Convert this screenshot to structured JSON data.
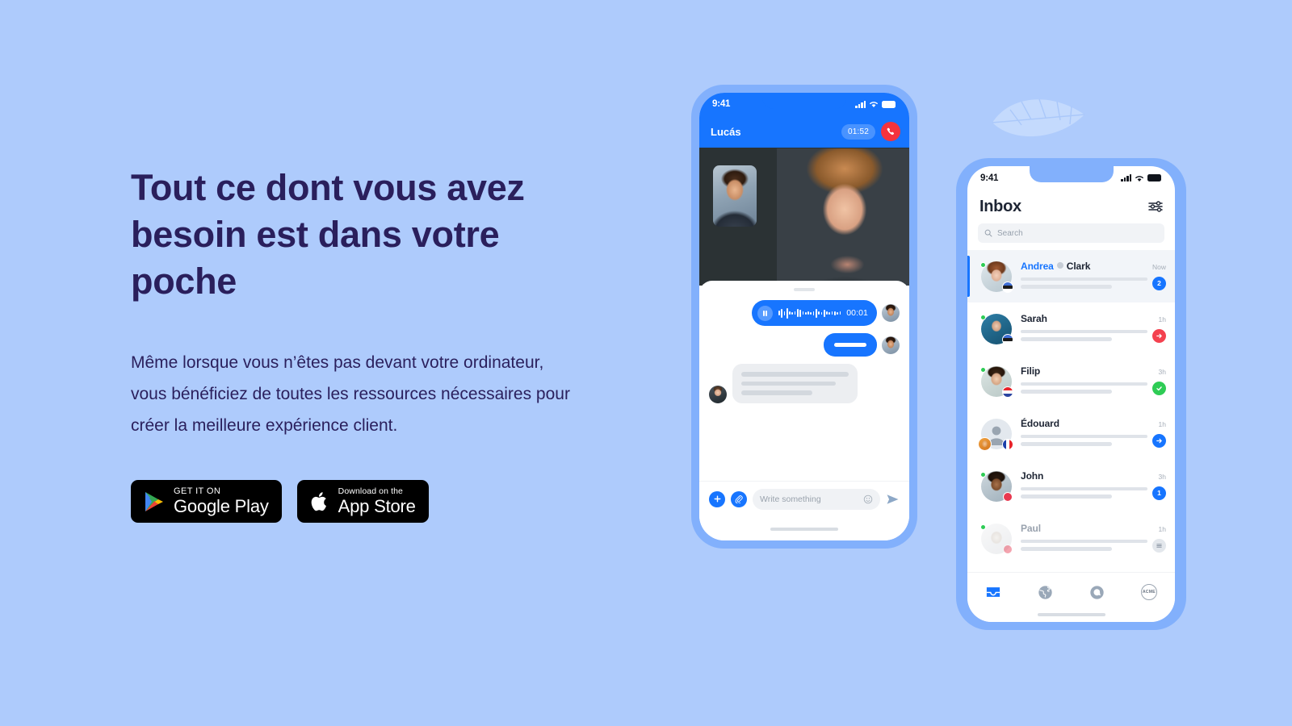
{
  "hero": {
    "headline": "Tout ce dont vous avez besoin est dans votre poche",
    "subcopy": "Même lorsque vous n’êtes pas devant votre ordinateur, vous bénéficiez de toutes les ressources nécessaires pour créer la meilleure expérience client.",
    "badges": [
      {
        "small": "GET IT ON",
        "big": "Google Play",
        "icon": "google-play-icon"
      },
      {
        "small": "Download on the",
        "big": "App Store",
        "icon": "apple-icon"
      }
    ]
  },
  "call_phone": {
    "status": {
      "time": "9:41",
      "signal": "signal-bars-icon",
      "wifi": "wifi-icon",
      "battery": "battery-icon"
    },
    "caller_name": "Lucás",
    "call_timer": "01:52",
    "hangup_label": "hangup-button",
    "messages": {
      "voice": {
        "duration": "00:01",
        "control": "pause-icon"
      },
      "text_bubble": "outgoing-message",
      "incoming_skeleton": "incoming-message"
    },
    "composer": {
      "placeholder": "Write something",
      "add_label": "add-attachment",
      "clip_label": "paperclip",
      "emoji_label": "emoji",
      "send_label": "send"
    }
  },
  "inbox_phone": {
    "status": {
      "time": "9:41"
    },
    "title": "Inbox",
    "filter_label": "filters",
    "search": {
      "placeholder": "Search"
    },
    "conversations": [
      {
        "name_primary": "Andrea",
        "name_secondary": "Clark",
        "time": "Now",
        "badge": "2",
        "badge_type": "count-blue",
        "online": true,
        "flag": "ee",
        "active": true
      },
      {
        "name_primary": "Sarah",
        "name_secondary": "",
        "time": "1h",
        "badge": "→",
        "badge_type": "arrow-red",
        "online": true,
        "flag": "ee",
        "active": false
      },
      {
        "name_primary": "Filip",
        "name_secondary": "",
        "time": "3h",
        "badge": "✓",
        "badge_type": "check-green",
        "online": true,
        "flag": "hr",
        "active": false
      },
      {
        "name_primary": "Édouard",
        "name_secondary": "",
        "time": "1h",
        "badge": "→",
        "badge_type": "arrow-blue",
        "online": false,
        "flag": "fr",
        "active": false
      },
      {
        "name_primary": "John",
        "name_secondary": "",
        "time": "3h",
        "badge": "1",
        "badge_type": "count-blue",
        "online": true,
        "flag": "dot",
        "active": false
      },
      {
        "name_primary": "Paul",
        "name_secondary": "",
        "time": "1h",
        "badge": "≡",
        "badge_type": "menu-grey",
        "online": true,
        "flag": "dot",
        "active": false
      }
    ],
    "tabs": [
      {
        "icon": "inbox-tray-icon",
        "active": true
      },
      {
        "icon": "globe-icon",
        "active": false
      },
      {
        "icon": "chat-bubble-icon",
        "active": false
      },
      {
        "icon": "acme-logo-icon",
        "label": "ACME",
        "active": false
      }
    ]
  },
  "decor": {
    "leaf": "leaf-icon"
  },
  "colors": {
    "background": "#aecbfc",
    "phone_frame": "#82b0fc",
    "accent_blue": "#1775ff",
    "headline": "#2a1f5c",
    "red": "#f4333d",
    "green": "#2ecc55"
  }
}
